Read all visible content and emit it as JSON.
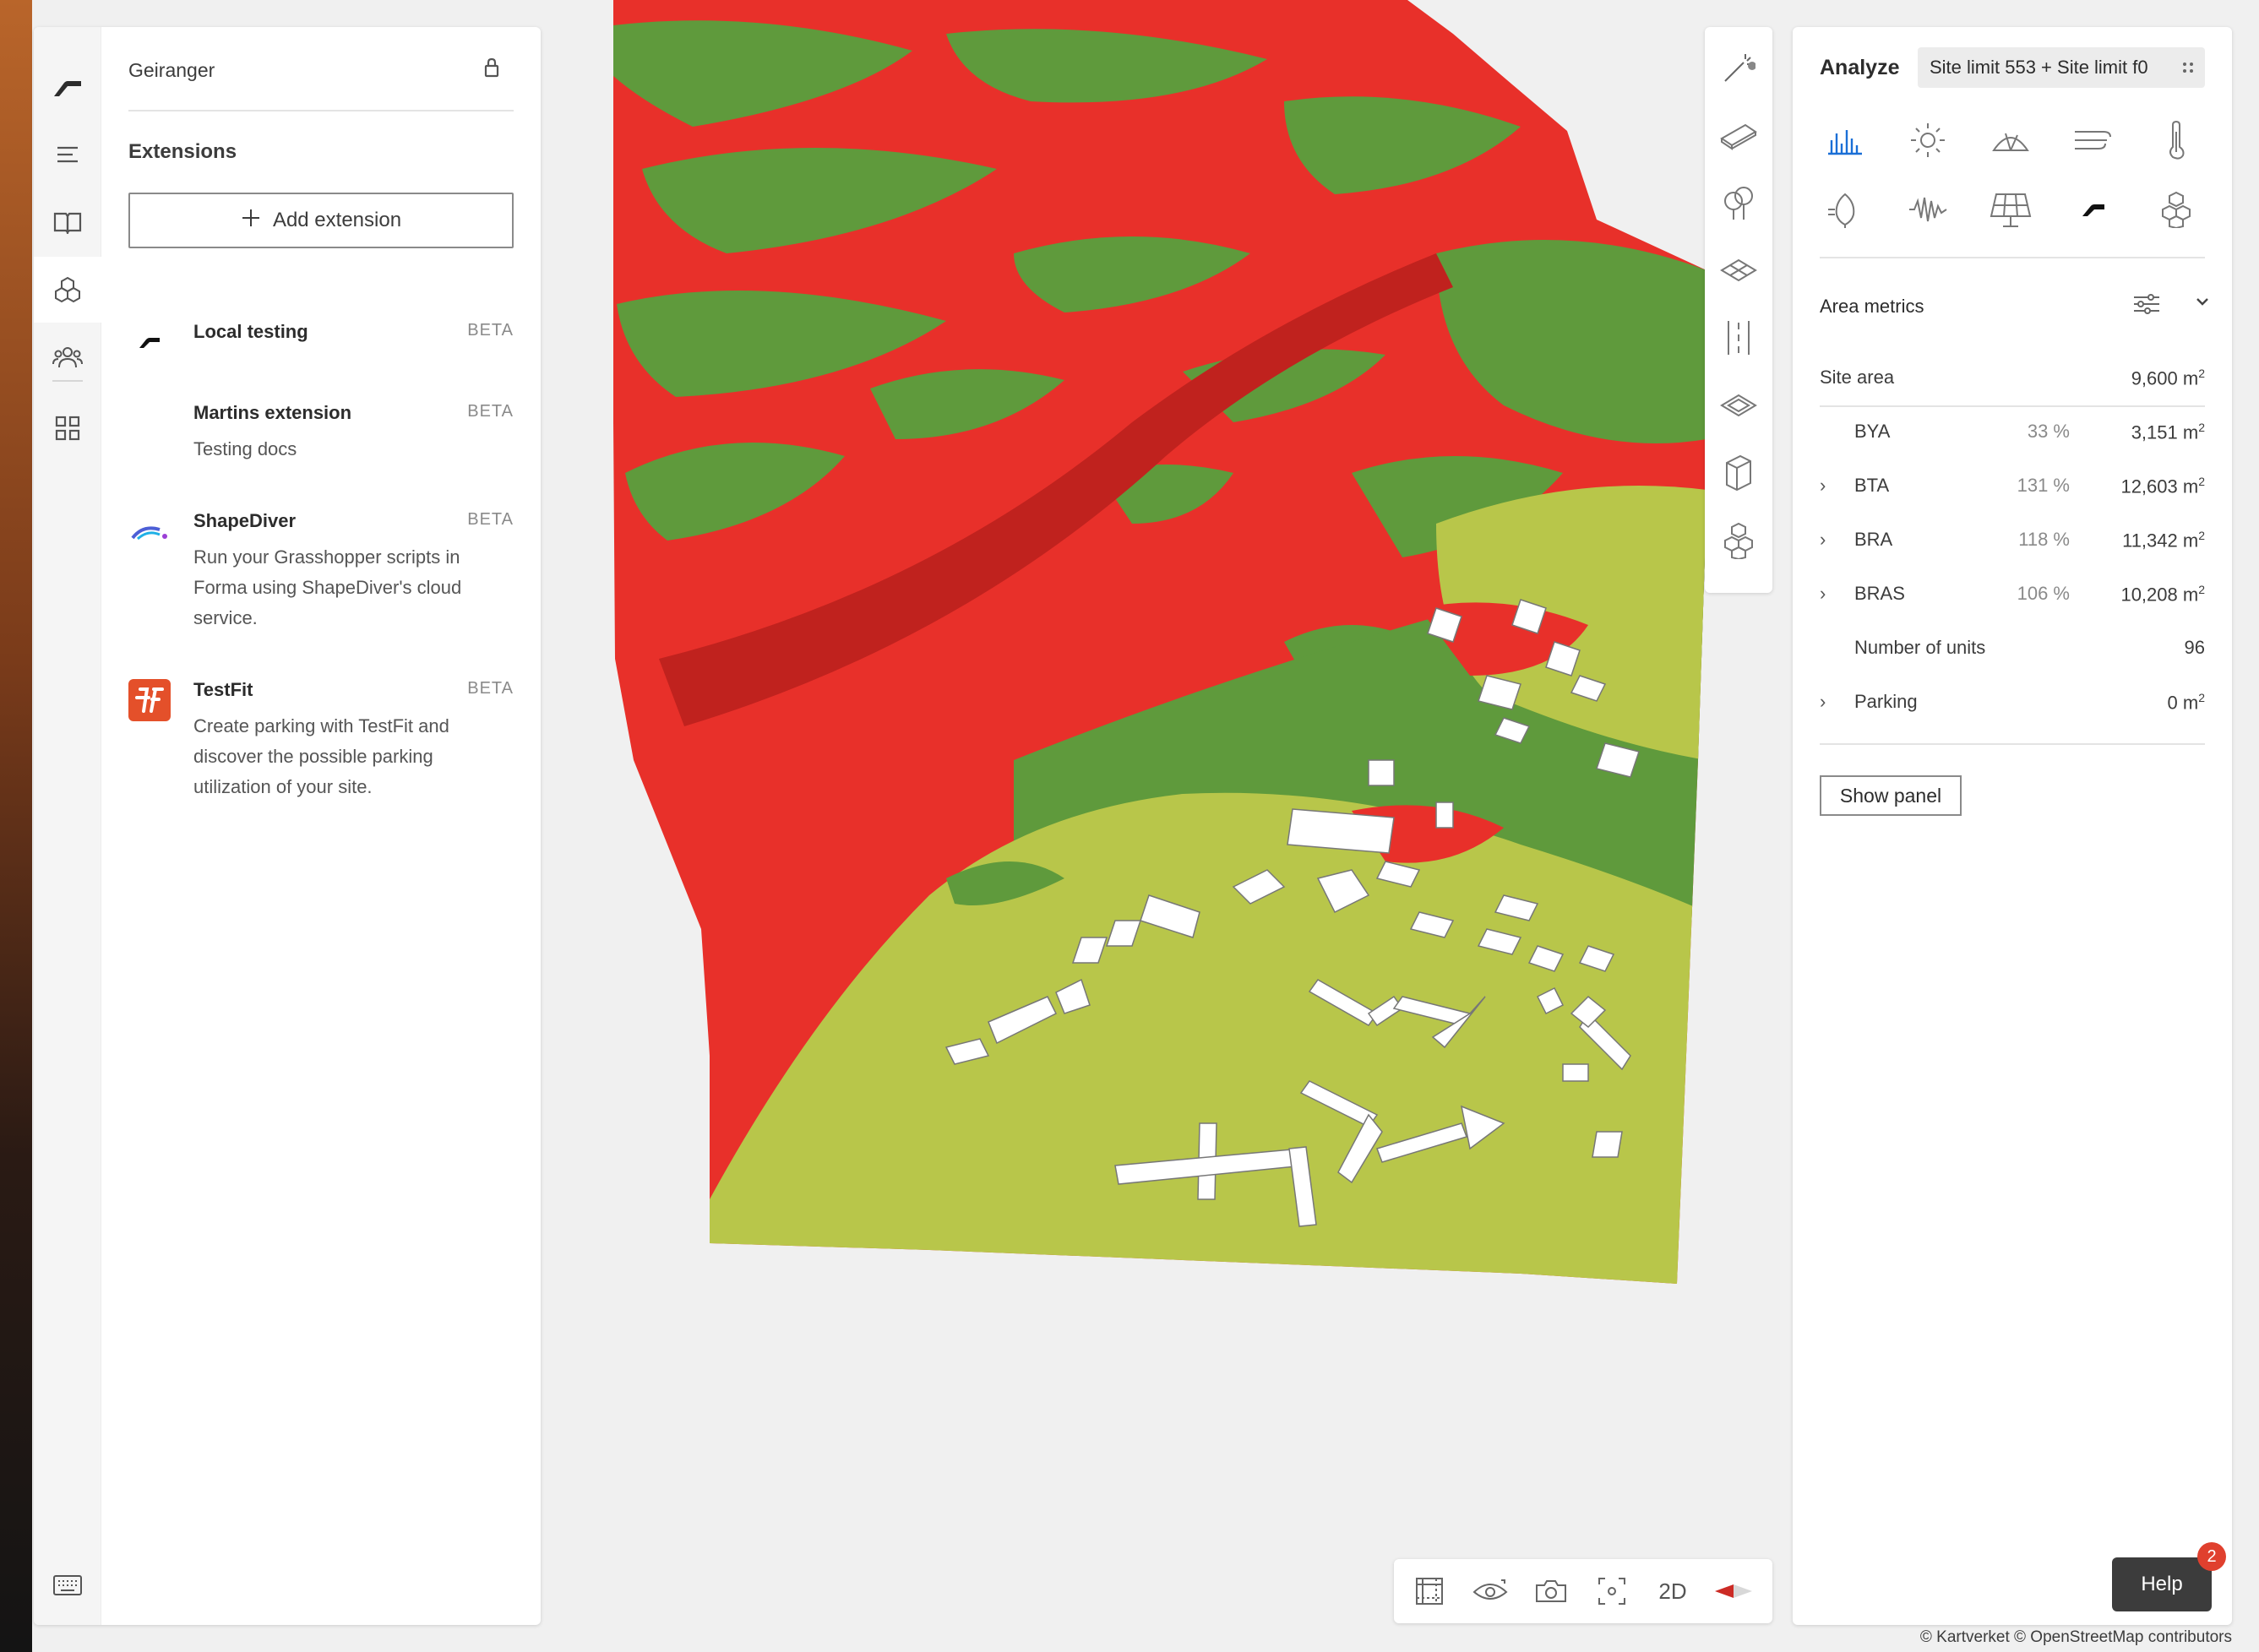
{
  "project": {
    "title": "Geiranger"
  },
  "extensions": {
    "heading": "Extensions",
    "add_label": "Add extension",
    "items": [
      {
        "name": "Local testing",
        "badge": "BETA",
        "description": "",
        "logo": "forma-logo"
      },
      {
        "name": "Martins extension",
        "badge": "BETA",
        "description": "Testing docs",
        "logo": ""
      },
      {
        "name": "ShapeDiver",
        "badge": "BETA",
        "description": "Run your Grasshopper scripts in Forma using ShapeDiver's cloud service.",
        "logo": "shapediver-logo"
      },
      {
        "name": "TestFit",
        "badge": "BETA",
        "description": "Create parking with TestFit and discover the possible parking utilization of your site.",
        "logo": "testfit-logo"
      }
    ]
  },
  "rail": {
    "items": [
      "forma-logo",
      "layers-icon",
      "book-icon",
      "cubes-icon",
      "people-icon",
      "apps-icon"
    ],
    "bottom": "keyboard-icon"
  },
  "tools": [
    "magic-wand-icon",
    "terrain-icon",
    "tree-icon",
    "zone-icon",
    "road-icon",
    "plane-icon",
    "building-icon",
    "cluster-icon"
  ],
  "analyze": {
    "title": "Analyze",
    "site_selector": "Site limit 553 + Site limit f0",
    "analysis_icons": [
      "bar-chart-icon",
      "sun-icon",
      "daylight-icon",
      "wind-icon",
      "thermometer-icon",
      "energy-icon",
      "noise-icon",
      "solar-panel-icon",
      "forma-icon",
      "cubes-icon"
    ],
    "area_metrics": {
      "title": "Area metrics",
      "rows": [
        {
          "label": "Site area",
          "pct": "",
          "value": "9,600",
          "unit": "m",
          "expandable": false,
          "indent": false
        },
        {
          "label": "BYA",
          "pct": "33 %",
          "value": "3,151",
          "unit": "m",
          "expandable": false,
          "indent": true
        },
        {
          "label": "BTA",
          "pct": "131 %",
          "value": "12,603",
          "unit": "m",
          "expandable": true,
          "indent": true
        },
        {
          "label": "BRA",
          "pct": "118 %",
          "value": "11,342",
          "unit": "m",
          "expandable": true,
          "indent": true
        },
        {
          "label": "BRAS",
          "pct": "106 %",
          "value": "10,208",
          "unit": "m",
          "expandable": true,
          "indent": true
        },
        {
          "label": "Number of units",
          "pct": "",
          "value": "96",
          "unit": "",
          "expandable": false,
          "indent": true
        },
        {
          "label": "Parking",
          "pct": "",
          "value": "0",
          "unit": "m",
          "expandable": true,
          "indent": true
        }
      ],
      "unit_sup": "2",
      "show_panel": "Show panel"
    }
  },
  "bottom_toolbar": {
    "mode_label": "2D"
  },
  "help": {
    "label": "Help",
    "badge": "2"
  },
  "attribution": "© Kartverket © OpenStreetMap contributors",
  "colors": {
    "slope_red": "#e8302a",
    "slope_green": "#5f9a3c",
    "flat_yellow": "#b8c64a",
    "accent_blue": "#1a6fd6",
    "testfit_orange": "#e4502a"
  }
}
